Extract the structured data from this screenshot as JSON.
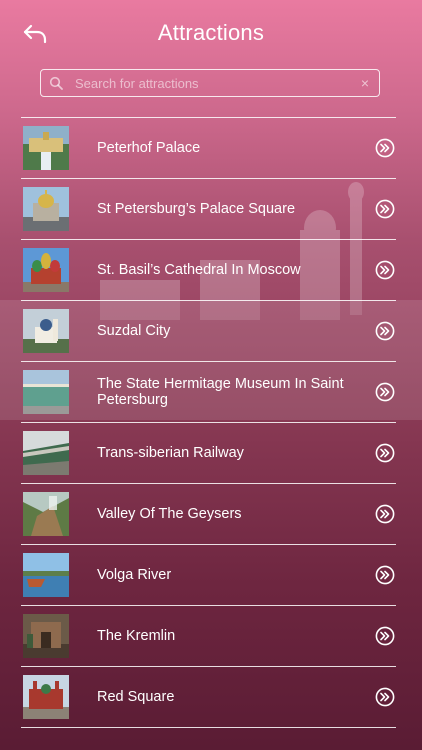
{
  "header": {
    "title": "Attractions",
    "back_icon": "back-arrow-icon"
  },
  "search": {
    "placeholder": "Search for attractions",
    "value": "",
    "clear_label": "×",
    "icon": "search-icon"
  },
  "colors": {
    "gradient_top": "#e97aa0",
    "gradient_bottom": "#5a1c34",
    "text": "#ffffff"
  },
  "attractions": [
    {
      "name": "Peterhof Palace",
      "thumb": "palace-fountain"
    },
    {
      "name": "St Petersburg’s Palace Square",
      "thumb": "cathedral-domes"
    },
    {
      "name": "St. Basil’s Cathedral In Moscow",
      "thumb": "onion-domes"
    },
    {
      "name": "Suzdal City",
      "thumb": "white-church"
    },
    {
      "name": "The State Hermitage Museum In Saint Petersburg",
      "thumb": "hermitage"
    },
    {
      "name": "Trans-siberian Railway",
      "thumb": "train"
    },
    {
      "name": "Valley Of The Geysers",
      "thumb": "valley"
    },
    {
      "name": "Volga River",
      "thumb": "river"
    },
    {
      "name": "The Kremlin",
      "thumb": "kremlin"
    },
    {
      "name": "Red Square",
      "thumb": "red-square"
    }
  ]
}
